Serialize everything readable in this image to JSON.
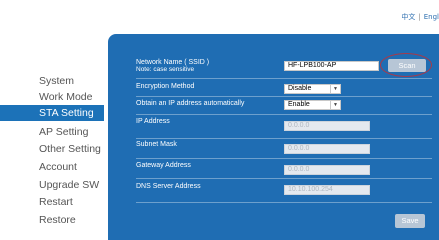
{
  "language": {
    "chinese": "中文",
    "separator": "|",
    "english": "Engl"
  },
  "sidebar": {
    "items": [
      {
        "label": "System"
      },
      {
        "label": "Work Mode"
      },
      {
        "label": "STA Setting",
        "active": true
      },
      {
        "label": "AP Setting"
      },
      {
        "label": "Other Setting"
      },
      {
        "label": "Account"
      },
      {
        "label": "Upgrade SW"
      },
      {
        "label": "Restart"
      },
      {
        "label": "Restore"
      }
    ]
  },
  "form": {
    "ssid": {
      "label": "Network Name ( SSID )",
      "note": "Note: case sensitive",
      "value": "HF-LPB100-AP"
    },
    "scan_label": "Scan",
    "encryption": {
      "label": "Encryption Method",
      "value": "Disable"
    },
    "dhcp": {
      "label": "Obtain an IP address automatically",
      "value": "Enable"
    },
    "ip_address": {
      "label": "IP Address",
      "value": "0.0.0.0"
    },
    "subnet_mask": {
      "label": "Subnet Mask",
      "value": "0.0.0.0"
    },
    "gateway": {
      "label": "Gateway Address",
      "value": "0.0.0.0"
    },
    "dns": {
      "label": "DNS Server Address",
      "value": "10.10.100.254"
    },
    "save_label": "Save"
  },
  "colors": {
    "panel": "#1f6db3",
    "active_nav": "#1c72b8",
    "highlight_ring": "#a63a4a"
  }
}
